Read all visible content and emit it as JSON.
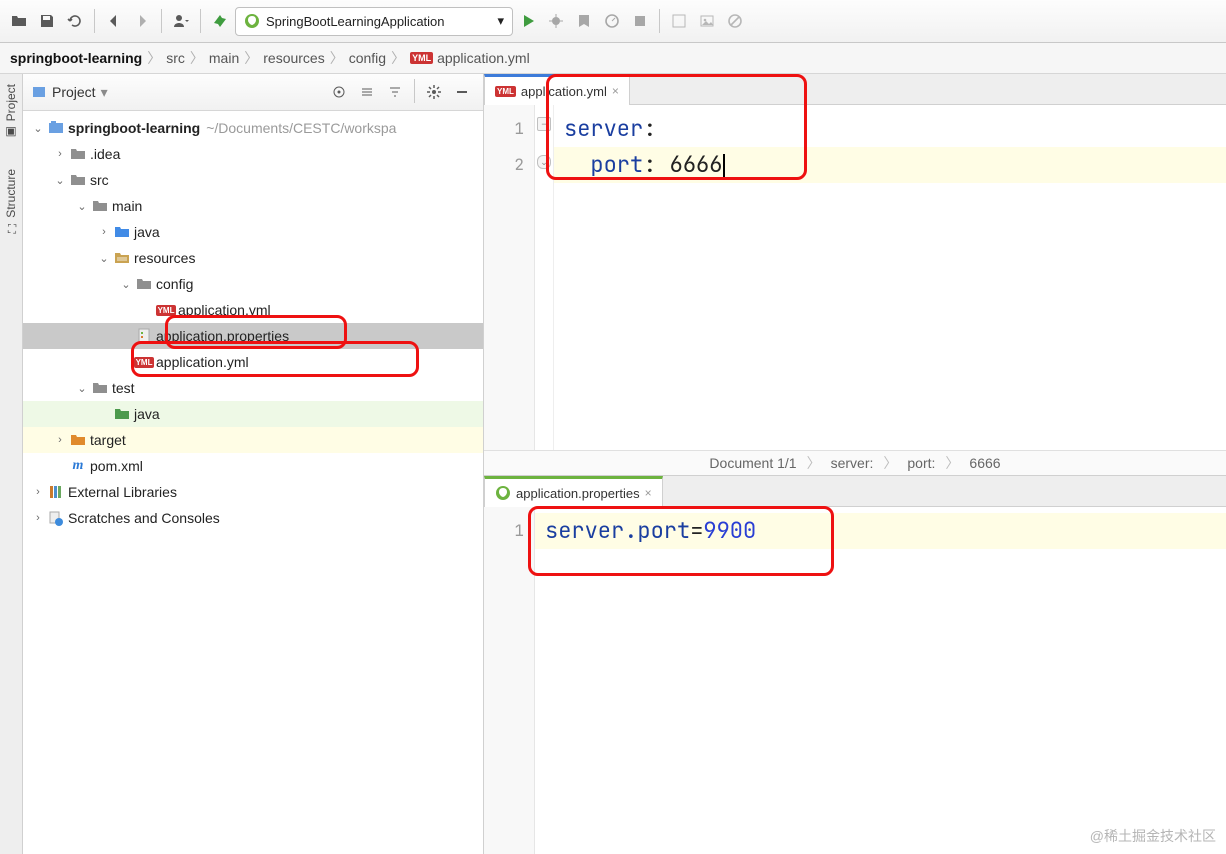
{
  "toolbar": {
    "run_config": "SpringBootLearningApplication"
  },
  "breadcrumb": {
    "root": "springboot-learning",
    "items": [
      "src",
      "main",
      "resources",
      "config",
      "application.yml"
    ]
  },
  "sidebar": {
    "title": "Project",
    "root": {
      "name": "springboot-learning",
      "path": "~/Documents/CESTC/workspa"
    },
    "nodes": {
      "idea": ".idea",
      "src": "src",
      "main": "main",
      "java": "java",
      "resources": "resources",
      "config": "config",
      "app_yml_config": "application.yml",
      "app_props": "application.properties",
      "app_yml_root": "application.yml",
      "test": "test",
      "test_java": "java",
      "target": "target",
      "pom": "pom.xml",
      "ext_libs": "External Libraries",
      "scratches": "Scratches and Consoles"
    }
  },
  "editors": {
    "top": {
      "tab": "application.yml",
      "lines": [
        "1",
        "2"
      ],
      "line1_key": "server",
      "line2_key": "port",
      "line2_val": "6666"
    },
    "bottom": {
      "tab": "application.properties",
      "lines": [
        "1"
      ],
      "prop_key": "server.port",
      "prop_val": "9900"
    }
  },
  "status": {
    "doc": "Document 1/1",
    "p1": "server:",
    "p2": "port:",
    "p3": "6666"
  },
  "left_gutter": {
    "project": "Project",
    "structure": "Structure"
  },
  "watermark": "@稀土掘金技术社区"
}
